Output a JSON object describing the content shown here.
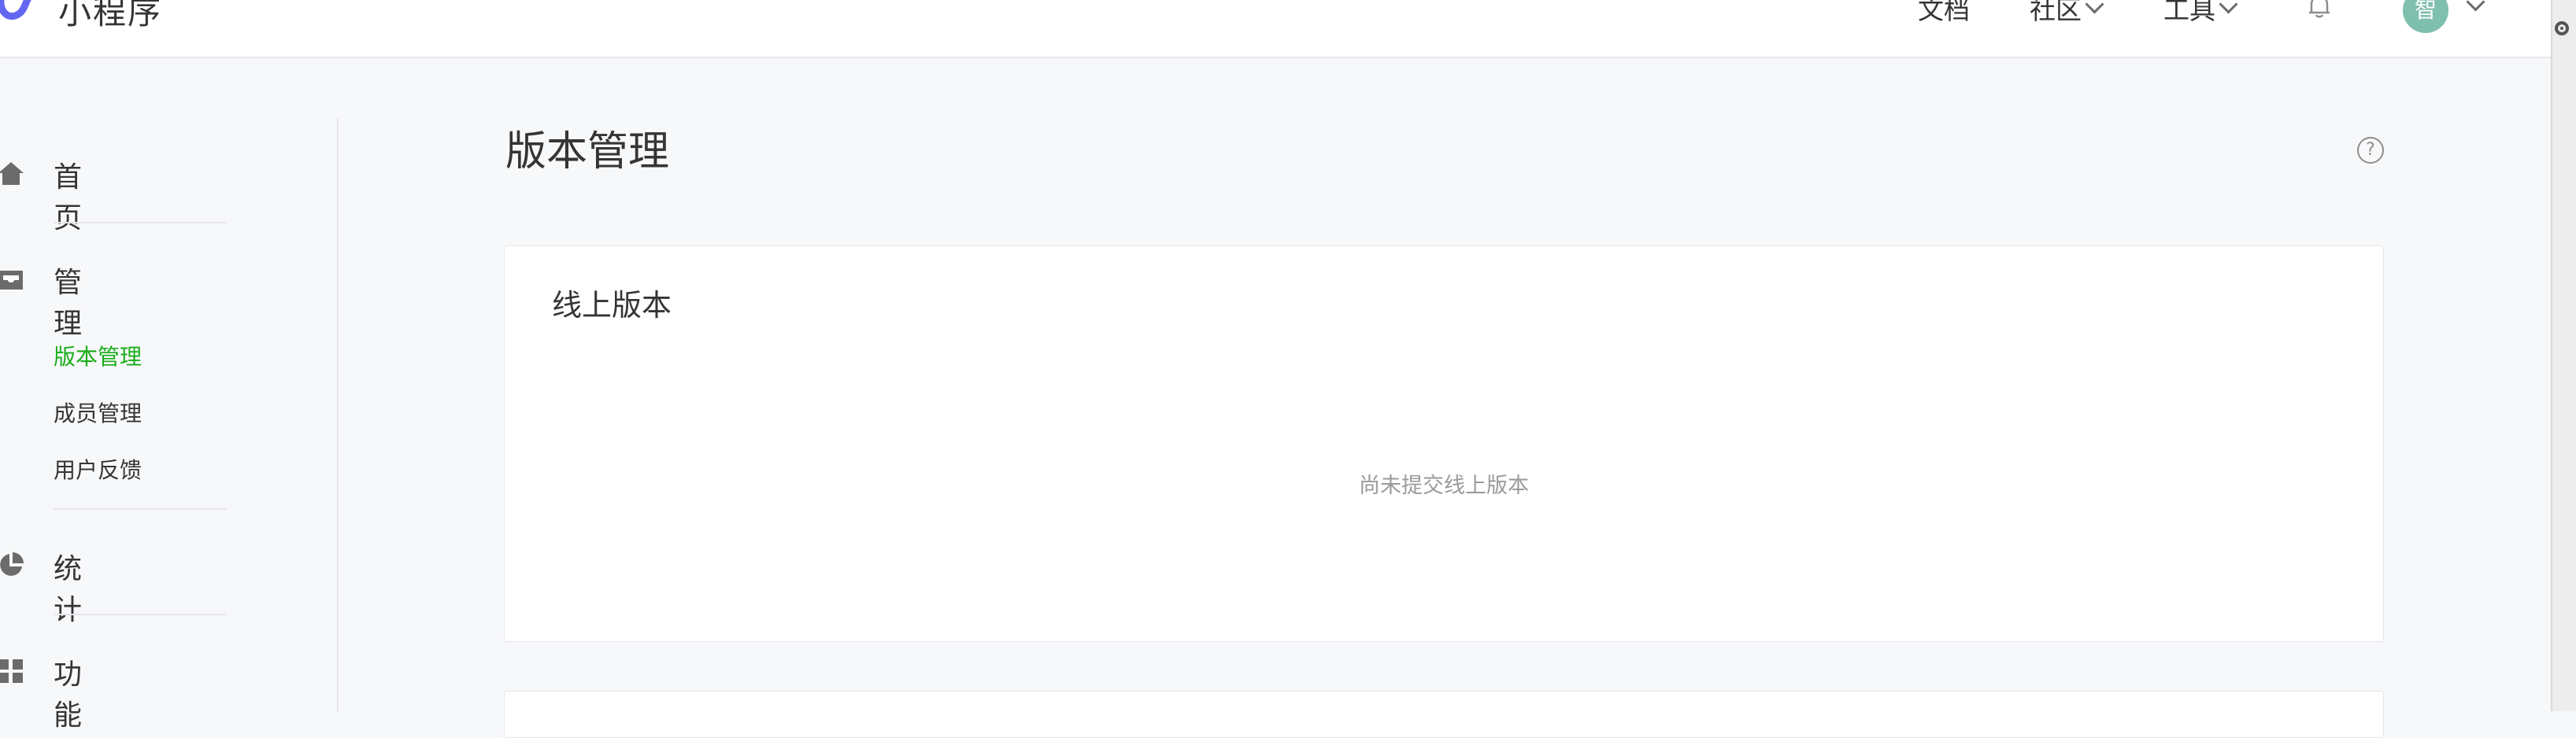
{
  "app": {
    "title": "小程序"
  },
  "topnav": {
    "docs": "文档",
    "community": "社区",
    "tools": "工具",
    "avatar_text": "智"
  },
  "sidebar": {
    "home": "首页",
    "manage": "管理",
    "manage_items": [
      "版本管理",
      "成员管理",
      "用户反馈"
    ],
    "stats": "统计",
    "features": "功能"
  },
  "main": {
    "page_title": "版本管理",
    "help_text": "?",
    "card": {
      "title": "线上版本",
      "empty_text": "尚未提交线上版本"
    }
  },
  "colors": {
    "accent": "#1aad19",
    "logo": "#6467f0",
    "avatar_bg": "#7fbfad"
  }
}
